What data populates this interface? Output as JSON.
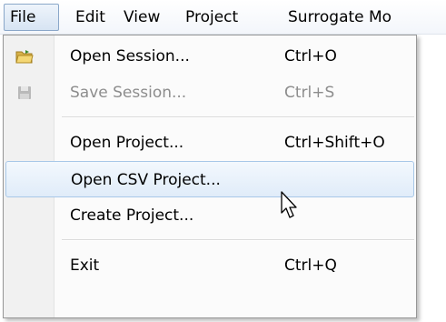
{
  "menubar": {
    "items": [
      {
        "label": "File"
      },
      {
        "label": "Edit"
      },
      {
        "label": "View"
      },
      {
        "label": "Project"
      },
      {
        "label": "Surrogate Mo"
      }
    ]
  },
  "file_menu": {
    "items": [
      {
        "label": "Open Session...",
        "shortcut": "Ctrl+O",
        "icon": "folder-open-icon"
      },
      {
        "label": "Save Session...",
        "shortcut": "Ctrl+S",
        "icon": "floppy-disk-icon",
        "enabled": false
      },
      {
        "label": "Open Project...",
        "shortcut": "Ctrl+Shift+O"
      },
      {
        "label": "Open CSV Project...",
        "shortcut": "",
        "highlighted": true
      },
      {
        "label": "Create Project...",
        "shortcut": ""
      },
      {
        "label": "Exit",
        "shortcut": "Ctrl+Q"
      }
    ]
  },
  "colors": {
    "highlight_border": "#a8c8e8",
    "highlight_fill": "#e0ecf9",
    "disabled_text": "#8d8d8d",
    "active_menu_border": "#8aa7c9"
  }
}
